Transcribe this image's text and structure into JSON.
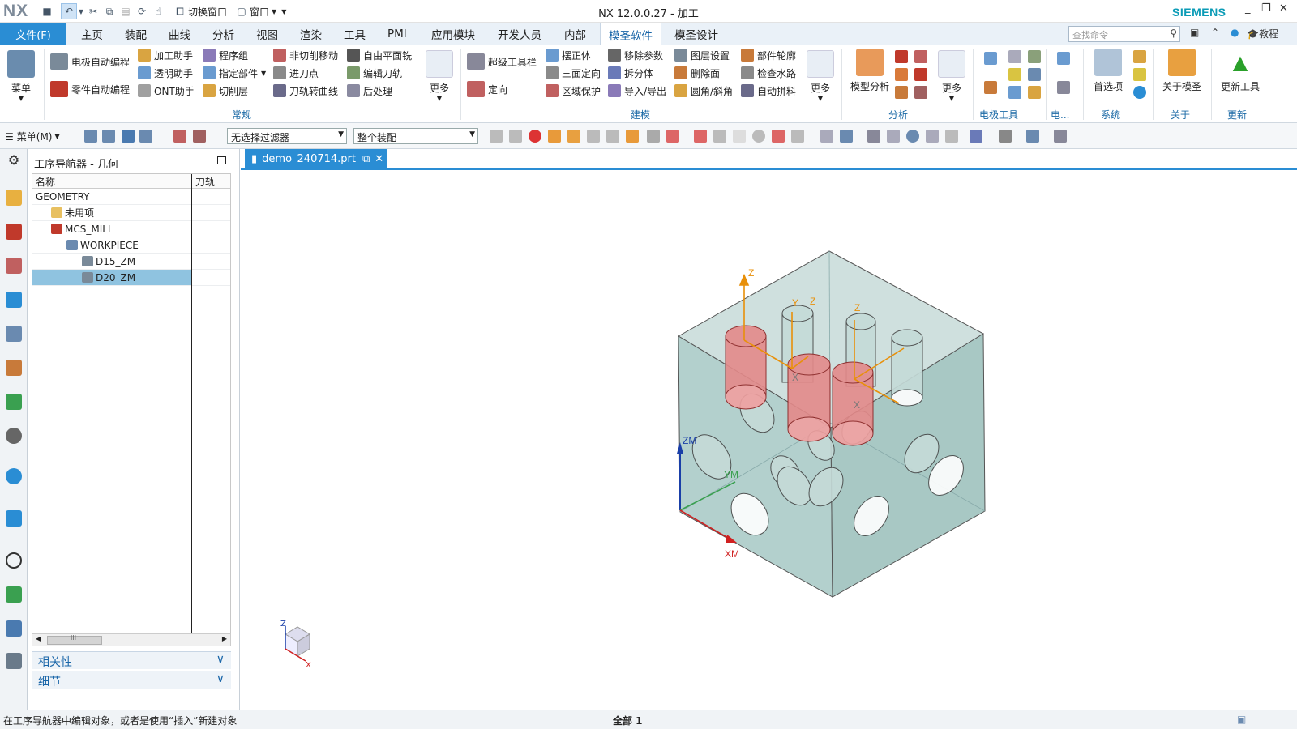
{
  "app": {
    "logo": "NX",
    "title": "NX 12.0.0.27 - 加工",
    "brand": "SIEMENS",
    "switch_window": "切换窗口",
    "window": "窗口"
  },
  "menu": {
    "file": "文件(F)",
    "tabs": [
      "主页",
      "装配",
      "曲线",
      "分析",
      "视图",
      "渲染",
      "工具",
      "PMI",
      "应用模块",
      "开发人员",
      "内部",
      "模圣软件",
      "模圣设计"
    ],
    "active_tab": "模圣软件",
    "search_placeholder": "查找命令",
    "tutorial": "教程"
  },
  "ribbon": {
    "menu_btn": "菜单",
    "general": {
      "group": "常规",
      "items": [
        "电极自动编程",
        "零件自动编程",
        "加工助手",
        "透明助手",
        "ONT助手",
        "程序组",
        "指定部件",
        "切削层",
        "非切削移动",
        "进刀点",
        "刀轨转曲线",
        "自由平面铣",
        "编辑刀轨",
        "后处理"
      ],
      "more": "更多"
    },
    "modeling": {
      "group": "建模",
      "items": [
        "超级工具栏",
        "定向",
        "摆正体",
        "三面定向",
        "区域保护",
        "移除参数",
        "拆分体",
        "导入/导出",
        "图层设置",
        "删除面",
        "圆角/斜角",
        "部件轮廓",
        "检查水路",
        "自动拼料"
      ],
      "more": "更多"
    },
    "analysis": {
      "group": "分析",
      "model_analysis": "模型分析",
      "more": "更多"
    },
    "electrode": {
      "group": "电极工具",
      "group_short": "电..."
    },
    "system": {
      "group": "系统",
      "prefs": "首选项"
    },
    "about": {
      "group": "关于",
      "label": "关于模圣"
    },
    "update": {
      "group": "更新",
      "label": "更新工具"
    }
  },
  "toolbar": {
    "menu": "菜单(M)",
    "filter": "无选择过滤器",
    "assembly": "整个装配"
  },
  "navigator": {
    "title": "工序导航器 - 几何",
    "col_name": "名称",
    "col_path": "刀轨",
    "rows": [
      {
        "name": "GEOMETRY",
        "level": 0,
        "icon": "none"
      },
      {
        "name": "未用项",
        "level": 1,
        "icon": "folder-icon"
      },
      {
        "name": "MCS_MILL",
        "level": 1,
        "icon": "mcs-icon"
      },
      {
        "name": "WORKPIECE",
        "level": 2,
        "icon": "workpiece-icon"
      },
      {
        "name": "D15_ZM",
        "level": 3,
        "icon": "geometry-icon"
      },
      {
        "name": "D20_ZM",
        "level": 3,
        "icon": "geometry-icon",
        "selected": true
      }
    ],
    "scroll_label": "III",
    "panels": [
      "相关性",
      "细节"
    ]
  },
  "document": {
    "tab": "demo_240714.prt"
  },
  "viewport": {
    "axis_labels": {
      "z": "Z",
      "x": "X",
      "y": "Y",
      "zm": "ZM",
      "ym": "YM",
      "xm": "XM"
    }
  },
  "status": {
    "message": "在工序导航器中编辑对象，或者是使用“插入”新建对象",
    "center": "全部 1"
  }
}
